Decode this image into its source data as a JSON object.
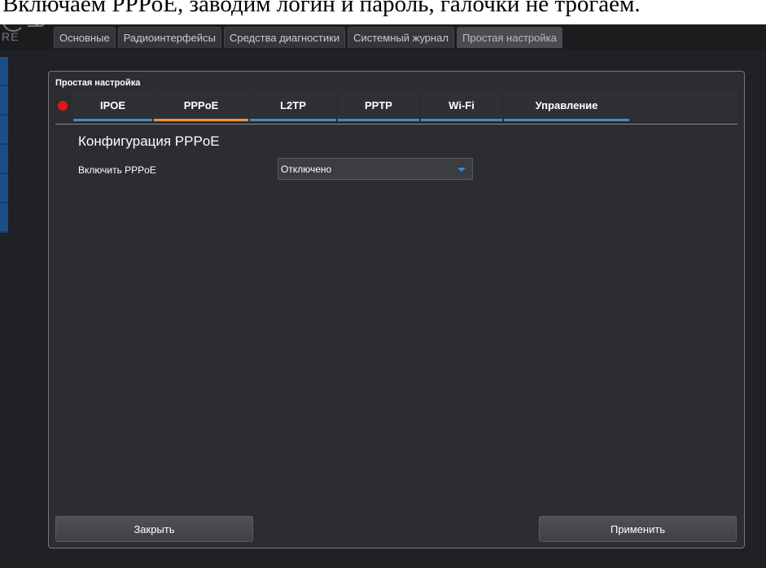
{
  "caption": "Включаем PPPoE, заводим логин и пароль, галочки не трогаем.",
  "header": {
    "logo_text": "RE",
    "tabs": [
      {
        "label": "Основные"
      },
      {
        "label": "Радиоинтерфейсы"
      },
      {
        "label": "Средства диагностики"
      },
      {
        "label": "Системный журнал"
      },
      {
        "label": "Простая настройка",
        "active": true
      }
    ]
  },
  "dialog": {
    "title": "Простая настройка",
    "status_color": "#e3141b",
    "tabs": [
      {
        "label": "IPOE"
      },
      {
        "label": "PPPoE",
        "active": true
      },
      {
        "label": "L2TP"
      },
      {
        "label": "PPTP"
      },
      {
        "label": "Wi-Fi"
      },
      {
        "label": "Управление"
      }
    ],
    "section_heading": "Конфигурация PPPoE",
    "enable_label": "Включить PPPoE",
    "enable_value": "Отключено",
    "close_label": "Закрыть",
    "apply_label": "Применить"
  },
  "colors": {
    "tab_underline": "#3d8fc4",
    "active_tab_underline": "#e8973a",
    "rail": "#1d4d87"
  }
}
